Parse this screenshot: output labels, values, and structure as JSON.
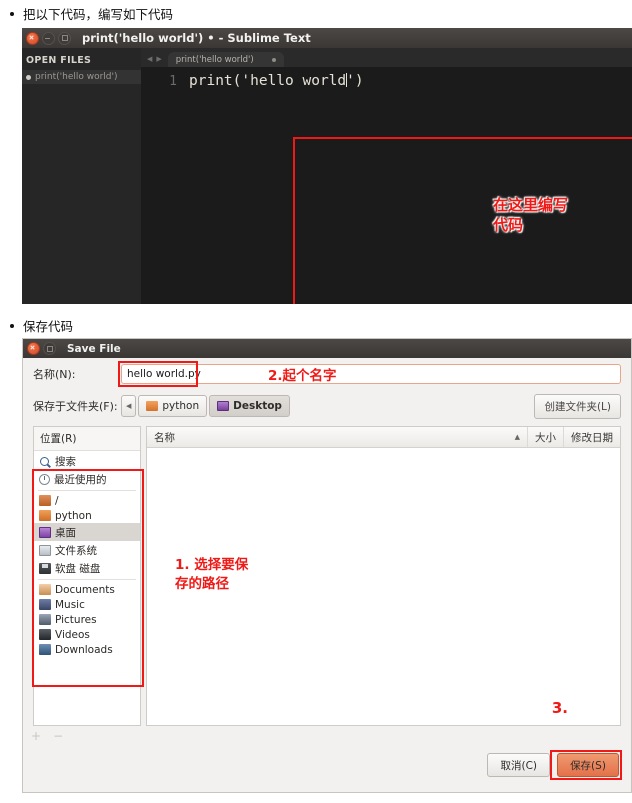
{
  "steps": [
    {
      "text": "把以下代码，编写如下代码"
    },
    {
      "text": "保存代码"
    }
  ],
  "sublime": {
    "window_title": "print('hello world') • - Sublime Text",
    "sidebar": {
      "section_label": "OPEN FILES",
      "open_files": [
        "print('hello world')"
      ]
    },
    "tab": {
      "label": "print('hello world')",
      "prev_arrow": "◀",
      "next_arrow": "▶"
    },
    "editor": {
      "line_number": "1",
      "code_before_caret": "print('hello world",
      "code_after_caret": "')",
      "annotation": "在这里编写\n代码"
    }
  },
  "save_dialog": {
    "window_title": "Save File",
    "name_field": {
      "label": "名称(N):",
      "value": "hello world.py"
    },
    "annotation_name": "2.起个名字",
    "folder_field": {
      "label": "保存于文件夹(F):",
      "back_arrow": "◀",
      "path_buttons": [
        {
          "label": "python",
          "icon": "folder-orange-icon",
          "selected": false
        },
        {
          "label": "Desktop",
          "icon": "desktop-folder-icon",
          "selected": true
        }
      ]
    },
    "new_folder_button": "创建文件夹(L)",
    "places": {
      "header": "位置(R)",
      "items": [
        {
          "label": "搜索",
          "icon": "search-icon",
          "selected": false
        },
        {
          "label": "最近使用的",
          "icon": "recent-icon",
          "selected": false
        },
        {
          "label": "/",
          "icon": "folder-root-icon",
          "selected": false
        },
        {
          "label": "python",
          "icon": "folder-orange-icon",
          "selected": false
        },
        {
          "label": "桌面",
          "icon": "desktop-folder-icon",
          "selected": true
        },
        {
          "label": "文件系统",
          "icon": "drive-icon",
          "selected": false
        },
        {
          "label": "软盘 磁盘",
          "icon": "floppy-icon",
          "selected": false
        },
        {
          "label": "Documents",
          "icon": "documents-folder-icon",
          "selected": false
        },
        {
          "label": "Music",
          "icon": "music-folder-icon",
          "selected": false
        },
        {
          "label": "Pictures",
          "icon": "pictures-folder-icon",
          "selected": false
        },
        {
          "label": "Videos",
          "icon": "videos-folder-icon",
          "selected": false
        },
        {
          "label": "Downloads",
          "icon": "downloads-folder-icon",
          "selected": false
        }
      ],
      "add_button": "+",
      "remove_button": "−"
    },
    "file_list": {
      "columns": {
        "name": "名称",
        "sort_indicator": "▲",
        "size": "大小",
        "date": "修改日期"
      },
      "rows": []
    },
    "annotation_path": "1. 选择要保\n存的路径",
    "annotation_save": "3.",
    "buttons": {
      "cancel": "取消(C)",
      "save": "保存(S)"
    }
  },
  "colors": {
    "annotation_red": "#ef1a17",
    "accent_orange": "#e3714a",
    "titlebar_dark": "#3a3734",
    "editor_bg": "#1b1b1b"
  }
}
